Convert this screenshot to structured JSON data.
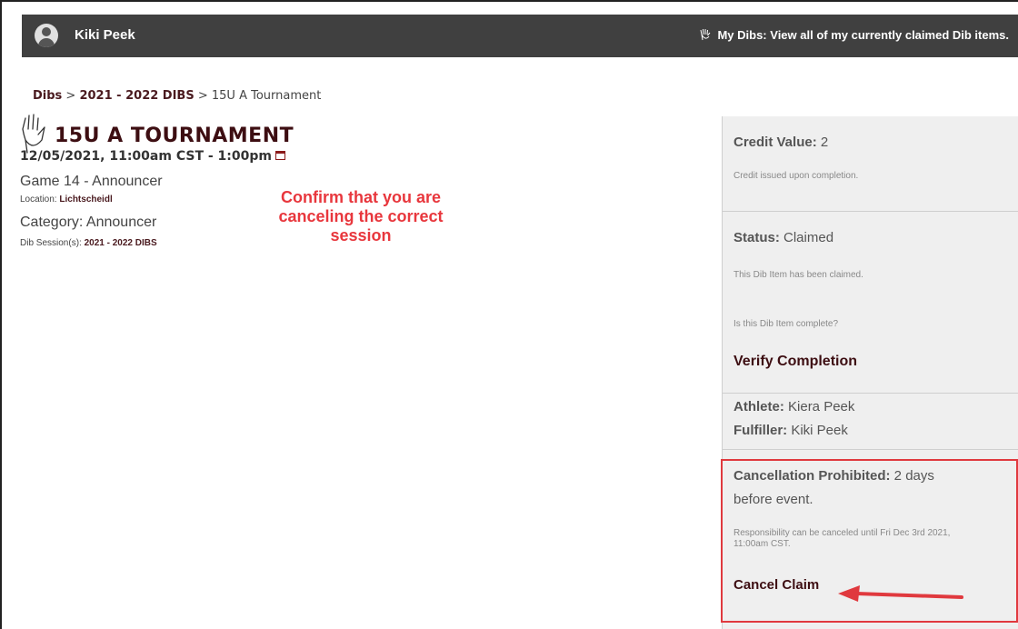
{
  "header": {
    "user_name": "Kiki Peek",
    "my_dibs": "My Dibs: View all of my currently claimed Dib items."
  },
  "breadcrumb": {
    "root": "Dibs",
    "separator1": " > ",
    "session": "2021 - 2022 DIBS",
    "separator2": " > ",
    "current": "15U A Tournament"
  },
  "event": {
    "title": "15U A TOURNAMENT",
    "datetime": "12/05/2021, 11:00am CST - 1:00pm",
    "game": "Game 14 - Announcer",
    "location_label": "Location: ",
    "location_value": "Lichtscheidl",
    "category": "Category: Announcer",
    "sessions_label": "Dib Session(s): ",
    "sessions_value": "2021 - 2022 DIBS"
  },
  "annotation": {
    "line1": "Confirm that you are",
    "line2": "canceling the correct",
    "line3": "session"
  },
  "sidebar": {
    "credit_label": "Credit Value:",
    "credit_value": " 2",
    "credit_note": "Credit issued upon completion.",
    "status_label": "Status:",
    "status_value": " Claimed",
    "status_note": "This Dib Item has been claimed.",
    "complete_question": "Is this Dib Item complete?",
    "verify_button": "Verify Completion",
    "athlete_label": "Athlete:",
    "athlete_value": " Kiera Peek",
    "fulfiller_label": "Fulfiller:",
    "fulfiller_value": " Kiki Peek",
    "cancel_label": "Cancellation Prohibited:",
    "cancel_value_1": " 2 days",
    "cancel_value_2": "before event.",
    "cancel_note_1": "Responsibility can be canceled until Fri Dec 3rd 2021,",
    "cancel_note_2": "11:00am CST.",
    "cancel_button": "Cancel Claim"
  },
  "colors": {
    "header_bg": "#404040",
    "brand_maroon": "#3d0e12",
    "annotation_red": "#e8373d",
    "sidebar_bg": "#efefef"
  }
}
